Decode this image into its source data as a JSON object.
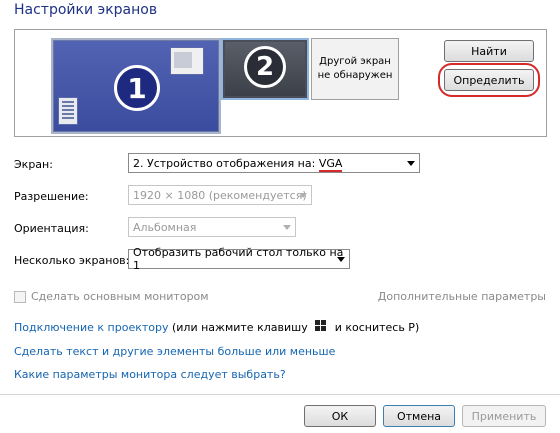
{
  "window": {
    "title": "Настройки экранов"
  },
  "preview": {
    "monitor1_number": "1",
    "monitor2_number": "2",
    "not_found_text_line1": "Другой экран",
    "not_found_text_line2": "не обнаружен",
    "find_button": "Найти",
    "identify_button": "Определить",
    "highlight_color": "#d42a2a"
  },
  "fields": {
    "screen": {
      "label": "Экран:",
      "value_prefix": "2. Устройство отображения на: ",
      "value_highlight": "VGA"
    },
    "resolution": {
      "label": "Разрешение:",
      "value": "1920 × 1080 (рекомендуется)"
    },
    "orientation": {
      "label": "Ориентация:",
      "value": "Альбомная"
    },
    "multiple": {
      "label": "Несколько экранов:",
      "value": "Отобразить рабочий стол только на 1"
    }
  },
  "checkbox": {
    "label": "Сделать основным монитором",
    "checked": false
  },
  "advanced_link": "Дополнительные параметры",
  "links": {
    "projector_link": "Подключение к проектору",
    "projector_suffix_before": " (или нажмите клавишу ",
    "projector_suffix_after": " и коснитесь P)",
    "text_size": "Сделать текст и другие элементы больше или меньше",
    "monitor_params": "Какие параметры монитора следует выбрать?"
  },
  "footer": {
    "ok": "ОК",
    "cancel": "Отмена",
    "apply": "Применить"
  },
  "colors": {
    "link": "#1665b0",
    "title": "#1e3287"
  }
}
